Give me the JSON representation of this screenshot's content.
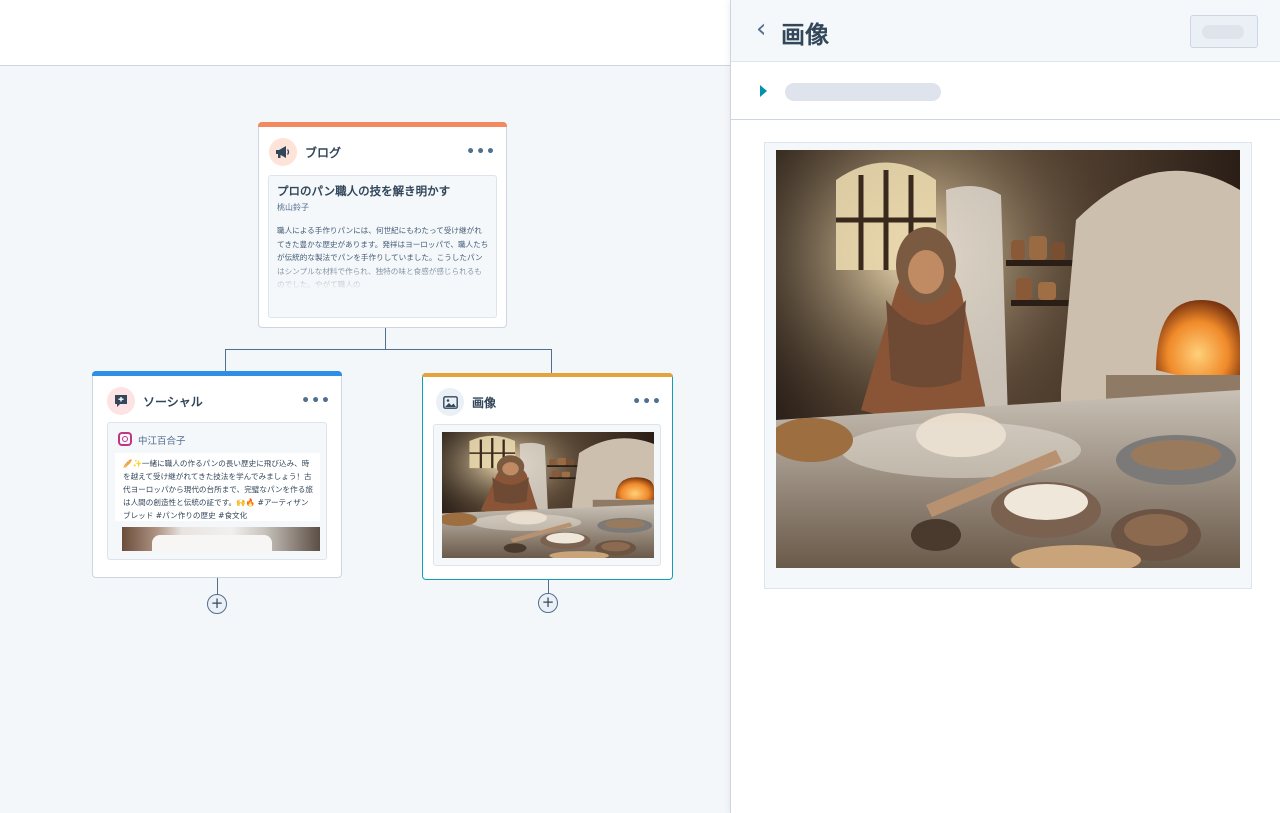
{
  "blog_card": {
    "title": "ブログ",
    "more": "•••",
    "post_title": "プロのパン職人の技を解き明かす",
    "author": "桃山鈴子",
    "body": "職人による手作りパンには、何世紀にもわたって受け継がれてきた豊かな歴史があります。発祥はヨーロッパで、職人たちが伝統的な製法でパンを手作りしていました。こうしたパンはシンプルな材料で作られ、独特の味と食感が感じられるものでした。やがて職人の",
    "accent_color": "#f2895f"
  },
  "social_card": {
    "title": "ソーシャル",
    "more": "•••",
    "account_name": "中江百合子",
    "post_text": "🥖✨一緒に職人の作るパンの長い歴史に飛び込み、時を越えて受け継がれてきた技法を学んでみましょう！古代ヨーロッパから現代の台所まで、完璧なパンを作る旅は人間の創造性と伝統の証です。🙌🔥 #アーティザンブレッド #パン作りの歴史 #食文化",
    "accent_color": "#2d8fe5"
  },
  "image_card": {
    "title": "画像",
    "more": "•••",
    "accent_color": "#e6a33a",
    "selected_border": "#0fa0b5"
  },
  "add_buttons": {
    "label": "+"
  },
  "panel": {
    "back_icon": "‹",
    "title": "画像"
  }
}
